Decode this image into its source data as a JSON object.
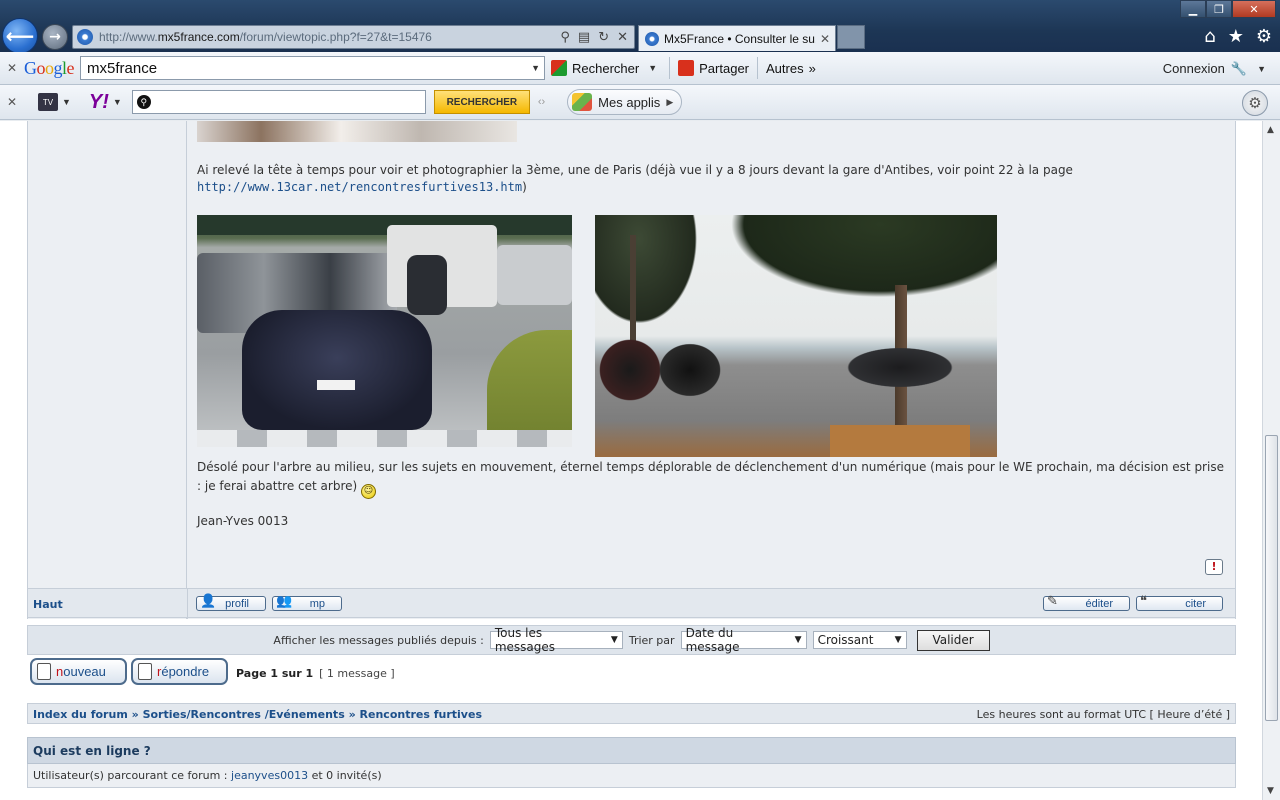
{
  "browser": {
    "url_prefix": "http://www.",
    "url_domain": "mx5france.com",
    "url_path": "/forum/viewtopic.php?f=27&t=15476",
    "tab_title": "Mx5France • Consulter le su...",
    "tab_close": "✕"
  },
  "google_bar": {
    "logo_letters": [
      "G",
      "o",
      "o",
      "g",
      "l",
      "e"
    ],
    "search_value": "mx5france",
    "search_label": "Rechercher",
    "share_label": "Partager",
    "more_label": "Autres",
    "login_label": "Connexion"
  },
  "yahoo_bar": {
    "tv_label": "TV",
    "logo": "Y!",
    "search_button": "RECHERCHER",
    "apps_label": "Mes applis"
  },
  "post": {
    "para1_text": "Ai relevé la tête à temps pour voir et photographier la 3ème, une de Paris (déjà vue il y a 8 jours devant la gare d'Antibes, voir point 22 à la page ",
    "para1_link": "http://www.13car.net/rencontresfurtives13.htm",
    "para1_tail": ")",
    "para2_text": "Désolé pour l'arbre au milieu, sur les sujets en mouvement, éternel temps déplorable de déclenchement d'un numérique (mais pour le WE prochain, ma décision est prise : je ferai abattre cet arbre) ",
    "signature": "Jean-Yves 0013",
    "report_glyph": "!"
  },
  "post_footer": {
    "top_link": "Haut",
    "profile_btn": "profil",
    "pm_btn": "mp",
    "edit_btn": "éditer",
    "quote_btn": "citer"
  },
  "sort_bar": {
    "show_label": "Afficher les messages publiés depuis :",
    "show_value": "Tous les messages",
    "sort_label": "Trier par",
    "sort_value": "Date du message",
    "order_value": "Croissant",
    "submit_label": "Valider"
  },
  "actions": {
    "new_topic_prefix": "n",
    "new_topic_rest": "ouveau",
    "reply_prefix": "r",
    "reply_rest": "épondre",
    "page_label": "Page 1 sur 1",
    "message_count": "[ 1 message ]"
  },
  "breadcrumb": {
    "items": [
      "Index du forum",
      "Sorties/Rencontres /Evénements",
      "Rencontres furtives"
    ],
    "separator": "»",
    "timezone_note": "Les heures sont au format UTC [ Heure d’été ]"
  },
  "online": {
    "heading": "Qui est en ligne ?",
    "prefix": "Utilisateur(s) parcourant ce forum : ",
    "user": "jeanyves0013",
    "suffix": " et 0 invité(s)"
  },
  "colors": {
    "link": "#1c4f8a",
    "chrome_dark": "#1d3655",
    "yahoo_purple": "#7b0099",
    "search_yellow": "#f5b800"
  }
}
